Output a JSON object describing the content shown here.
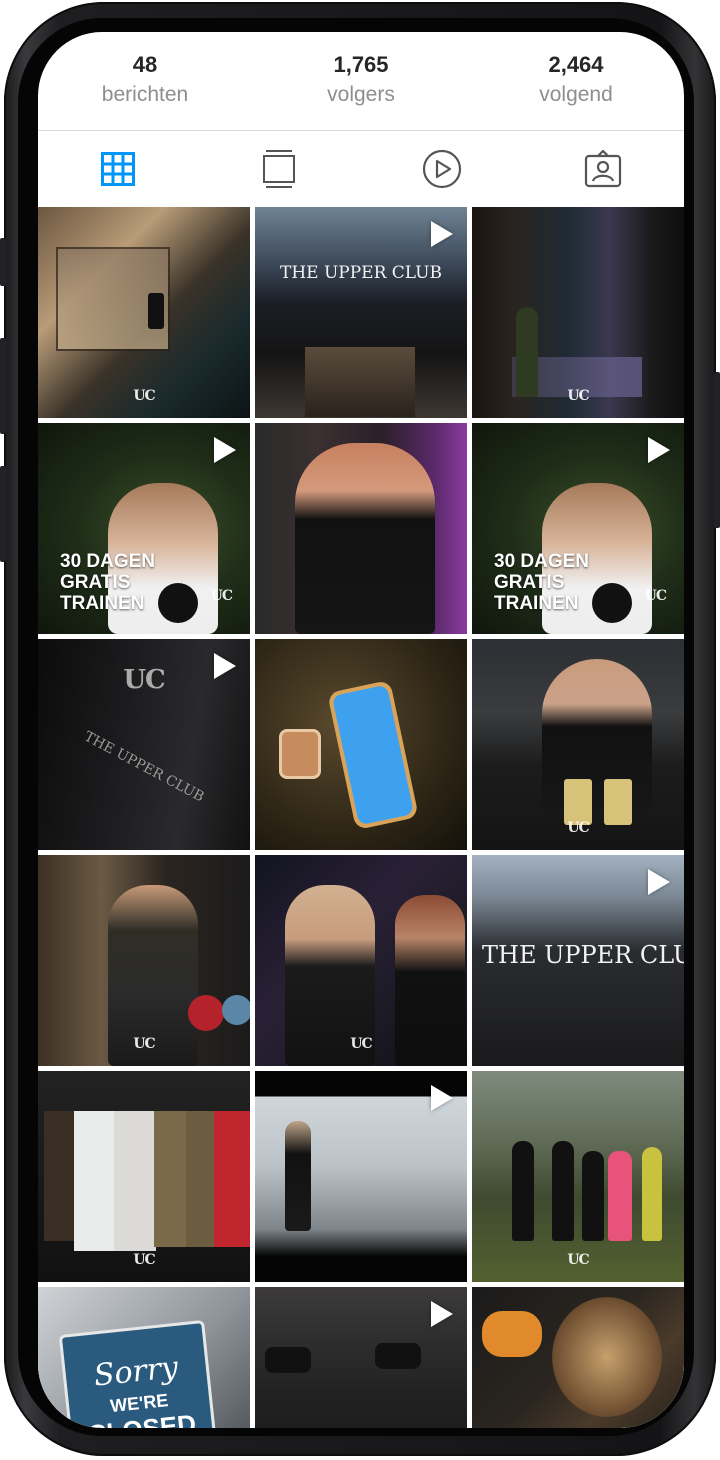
{
  "profile_stats": [
    {
      "count": "48",
      "label": "berichten"
    },
    {
      "count": "1,765",
      "label": "volgers"
    },
    {
      "count": "2,464",
      "label": "volgend"
    }
  ],
  "tabs": [
    {
      "name": "grid",
      "icon": "grid-icon",
      "active": true
    },
    {
      "name": "igtv",
      "icon": "igtv-icon",
      "active": false
    },
    {
      "name": "reels",
      "icon": "reels-icon",
      "active": false
    },
    {
      "name": "tagged",
      "icon": "tagged-user-icon",
      "active": false
    }
  ],
  "colors": {
    "accent": "#0095f6",
    "text": "#262626",
    "muted": "#8e8e8e",
    "divider": "#dbdbdb"
  },
  "posts": {
    "building_sign_1": "THE UPPER CLUB",
    "promo_text_line1": "30 DAGEN",
    "promo_text_line2": "GRATIS",
    "promo_text_line3": "TRAINEN",
    "building_sign_2": "THE UPPER CLU",
    "wall_sign": "THE UPPER CLUB",
    "sorry_sign_line1": "Sorry",
    "sorry_sign_line2": "WE'RE",
    "sorry_sign_line3": "CLOSED",
    "brand_logo": "UC"
  }
}
